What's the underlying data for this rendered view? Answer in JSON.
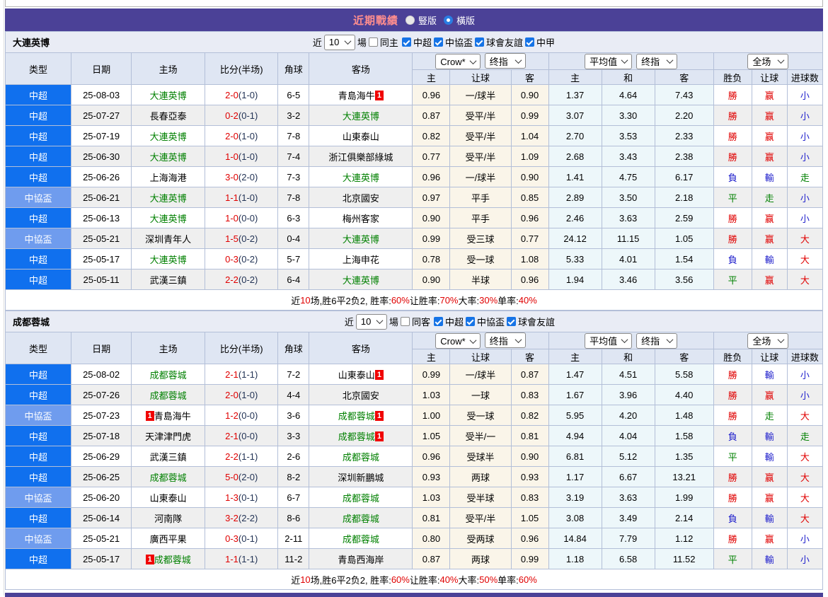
{
  "colors": {
    "header_purple": "#4b4197",
    "title_pink": "#ff8e8e",
    "type_colors": {
      "中超": "#1070ee",
      "中協盃": "#6f9cee"
    },
    "result_colors": {
      "勝": "red",
      "負": "blue",
      "平": "green",
      "赢": "red",
      "輸": "blue",
      "走": "green",
      "大": "red",
      "小": "blue"
    },
    "focus_team_green": "#008000",
    "score_red": "#e00000"
  },
  "title_bar": {
    "title": "近期戰績",
    "radios": [
      {
        "label": "豎版",
        "checked": false
      },
      {
        "label": "橫版",
        "checked": true
      }
    ]
  },
  "table_header": {
    "left_cols": [
      "类型",
      "日期",
      "主场",
      "比分(半场)",
      "角球",
      "客场"
    ],
    "groups": [
      {
        "selects": [
          "Crow*",
          "终指"
        ],
        "cols": [
          "主",
          "让球",
          "客"
        ]
      },
      {
        "selects": [
          "平均值",
          "终指"
        ],
        "cols": [
          "主",
          "和",
          "客"
        ]
      },
      {
        "selects": [
          "全场"
        ],
        "cols": [
          "胜负",
          "让球",
          "进球数"
        ]
      }
    ]
  },
  "sections": [
    {
      "team": "大連英博",
      "filter": {
        "near": "近",
        "games": "10",
        "unit": "場",
        "same": {
          "label": "同主",
          "checked": false
        },
        "leagues": [
          {
            "label": "中超",
            "checked": true
          },
          {
            "label": "中協盃",
            "checked": true
          },
          {
            "label": "球會友誼",
            "checked": true
          },
          {
            "label": "中甲",
            "checked": true
          }
        ]
      },
      "rows": [
        {
          "type": "中超",
          "date": "25-08-03",
          "home": {
            "name": "大連英博",
            "focus": true
          },
          "away": {
            "name": "青島海牛",
            "focus": false,
            "card": "after"
          },
          "score_ft": "2-0",
          "score_ht": "(1-0)",
          "corners": "6-5",
          "handicap": [
            "0.96",
            "一/球半",
            "0.90"
          ],
          "avg": [
            "1.37",
            "4.64",
            "7.43"
          ],
          "results": [
            "勝",
            "赢",
            "小"
          ]
        },
        {
          "type": "中超",
          "date": "25-07-27",
          "home": {
            "name": "長春亞泰",
            "focus": false
          },
          "away": {
            "name": "大連英博",
            "focus": true
          },
          "score_ft": "0-2",
          "score_ht": "(0-1)",
          "corners": "3-2",
          "handicap": [
            "0.87",
            "受平/半",
            "0.99"
          ],
          "avg": [
            "3.07",
            "3.30",
            "2.20"
          ],
          "results": [
            "勝",
            "赢",
            "小"
          ]
        },
        {
          "type": "中超",
          "date": "25-07-19",
          "home": {
            "name": "大連英博",
            "focus": true
          },
          "away": {
            "name": "山東泰山",
            "focus": false
          },
          "score_ft": "2-0",
          "score_ht": "(1-0)",
          "corners": "7-8",
          "handicap": [
            "0.82",
            "受平/半",
            "1.04"
          ],
          "avg": [
            "2.70",
            "3.53",
            "2.33"
          ],
          "results": [
            "勝",
            "赢",
            "小"
          ]
        },
        {
          "type": "中超",
          "date": "25-06-30",
          "home": {
            "name": "大連英博",
            "focus": true
          },
          "away": {
            "name": "浙江俱樂部綠城",
            "focus": false
          },
          "score_ft": "1-0",
          "score_ht": "(1-0)",
          "corners": "7-4",
          "handicap": [
            "0.77",
            "受平/半",
            "1.09"
          ],
          "avg": [
            "2.68",
            "3.43",
            "2.38"
          ],
          "results": [
            "勝",
            "赢",
            "小"
          ]
        },
        {
          "type": "中超",
          "date": "25-06-26",
          "home": {
            "name": "上海海港",
            "focus": false
          },
          "away": {
            "name": "大連英博",
            "focus": true
          },
          "score_ft": "3-0",
          "score_ht": "(2-0)",
          "corners": "7-3",
          "handicap": [
            "0.96",
            "一/球半",
            "0.90"
          ],
          "avg": [
            "1.41",
            "4.75",
            "6.17"
          ],
          "results": [
            "負",
            "輸",
            "走"
          ]
        },
        {
          "type": "中協盃",
          "date": "25-06-21",
          "home": {
            "name": "大連英博",
            "focus": true
          },
          "away": {
            "name": "北京國安",
            "focus": false
          },
          "score_ft": "1-1",
          "score_ht": "(1-0)",
          "corners": "7-8",
          "handicap": [
            "0.97",
            "平手",
            "0.85"
          ],
          "avg": [
            "2.89",
            "3.50",
            "2.18"
          ],
          "results": [
            "平",
            "走",
            "小"
          ]
        },
        {
          "type": "中超",
          "date": "25-06-13",
          "home": {
            "name": "大連英博",
            "focus": true
          },
          "away": {
            "name": "梅州客家",
            "focus": false
          },
          "score_ft": "1-0",
          "score_ht": "(0-0)",
          "corners": "6-3",
          "handicap": [
            "0.90",
            "平手",
            "0.96"
          ],
          "avg": [
            "2.46",
            "3.63",
            "2.59"
          ],
          "results": [
            "勝",
            "赢",
            "小"
          ]
        },
        {
          "type": "中協盃",
          "date": "25-05-21",
          "home": {
            "name": "深圳青年人",
            "focus": false
          },
          "away": {
            "name": "大連英博",
            "focus": true
          },
          "score_ft": "1-5",
          "score_ht": "(0-2)",
          "corners": "0-4",
          "handicap": [
            "0.99",
            "受三球",
            "0.77"
          ],
          "avg": [
            "24.12",
            "11.15",
            "1.05"
          ],
          "results": [
            "勝",
            "赢",
            "大"
          ]
        },
        {
          "type": "中超",
          "date": "25-05-17",
          "home": {
            "name": "大連英博",
            "focus": true
          },
          "away": {
            "name": "上海申花",
            "focus": false
          },
          "score_ft": "0-3",
          "score_ht": "(0-2)",
          "corners": "5-7",
          "handicap": [
            "0.78",
            "受一球",
            "1.08"
          ],
          "avg": [
            "5.33",
            "4.01",
            "1.54"
          ],
          "results": [
            "負",
            "輸",
            "大"
          ]
        },
        {
          "type": "中超",
          "date": "25-05-11",
          "home": {
            "name": "武漢三鎮",
            "focus": false
          },
          "away": {
            "name": "大連英博",
            "focus": true
          },
          "score_ft": "2-2",
          "score_ht": "(0-2)",
          "corners": "6-4",
          "handicap": [
            "0.90",
            "半球",
            "0.96"
          ],
          "avg": [
            "1.94",
            "3.46",
            "3.56"
          ],
          "results": [
            "平",
            "赢",
            "大"
          ]
        }
      ],
      "summary": [
        {
          "t": "近",
          "c": "k"
        },
        {
          "t": "10",
          "c": "r"
        },
        {
          "t": "场,胜6平2负2, 胜率:",
          "c": "k"
        },
        {
          "t": "60%",
          "c": "r"
        },
        {
          "t": " 让胜率:",
          "c": "k"
        },
        {
          "t": "70%",
          "c": "r"
        },
        {
          "t": " 大率:",
          "c": "k"
        },
        {
          "t": "30%",
          "c": "r"
        },
        {
          "t": " 单率:",
          "c": "k"
        },
        {
          "t": "40%",
          "c": "r"
        }
      ]
    },
    {
      "team": "成都蓉城",
      "filter": {
        "near": "近",
        "games": "10",
        "unit": "場",
        "same": {
          "label": "同客",
          "checked": false
        },
        "leagues": [
          {
            "label": "中超",
            "checked": true
          },
          {
            "label": "中協盃",
            "checked": true
          },
          {
            "label": "球會友誼",
            "checked": true
          }
        ]
      },
      "rows": [
        {
          "type": "中超",
          "date": "25-08-02",
          "home": {
            "name": "成都蓉城",
            "focus": true
          },
          "away": {
            "name": "山東泰山",
            "focus": false,
            "card": "after"
          },
          "score_ft": "2-1",
          "score_ht": "(1-1)",
          "corners": "7-2",
          "handicap": [
            "0.99",
            "一/球半",
            "0.87"
          ],
          "avg": [
            "1.47",
            "4.51",
            "5.58"
          ],
          "results": [
            "勝",
            "輸",
            "小"
          ]
        },
        {
          "type": "中超",
          "date": "25-07-26",
          "home": {
            "name": "成都蓉城",
            "focus": true
          },
          "away": {
            "name": "北京國安",
            "focus": false
          },
          "score_ft": "2-0",
          "score_ht": "(1-0)",
          "corners": "4-4",
          "handicap": [
            "1.03",
            "一球",
            "0.83"
          ],
          "avg": [
            "1.67",
            "3.96",
            "4.40"
          ],
          "results": [
            "勝",
            "赢",
            "小"
          ]
        },
        {
          "type": "中協盃",
          "date": "25-07-23",
          "home": {
            "name": "青島海牛",
            "focus": false,
            "card": "before"
          },
          "away": {
            "name": "成都蓉城",
            "focus": true,
            "card": "after"
          },
          "score_ft": "1-2",
          "score_ht": "(0-0)",
          "corners": "3-6",
          "handicap": [
            "1.00",
            "受一球",
            "0.82"
          ],
          "avg": [
            "5.95",
            "4.20",
            "1.48"
          ],
          "results": [
            "勝",
            "走",
            "大"
          ]
        },
        {
          "type": "中超",
          "date": "25-07-18",
          "home": {
            "name": "天津津門虎",
            "focus": false
          },
          "away": {
            "name": "成都蓉城",
            "focus": true,
            "card": "after"
          },
          "score_ft": "2-1",
          "score_ht": "(0-0)",
          "corners": "3-3",
          "handicap": [
            "1.05",
            "受半/一",
            "0.81"
          ],
          "avg": [
            "4.94",
            "4.04",
            "1.58"
          ],
          "results": [
            "負",
            "輸",
            "走"
          ]
        },
        {
          "type": "中超",
          "date": "25-06-29",
          "home": {
            "name": "武漢三鎮",
            "focus": false
          },
          "away": {
            "name": "成都蓉城",
            "focus": true
          },
          "score_ft": "2-2",
          "score_ht": "(1-1)",
          "corners": "2-6",
          "handicap": [
            "0.96",
            "受球半",
            "0.90"
          ],
          "avg": [
            "6.81",
            "5.12",
            "1.35"
          ],
          "results": [
            "平",
            "輸",
            "大"
          ]
        },
        {
          "type": "中超",
          "date": "25-06-25",
          "home": {
            "name": "成都蓉城",
            "focus": true
          },
          "away": {
            "name": "深圳新鵬城",
            "focus": false
          },
          "score_ft": "5-0",
          "score_ht": "(2-0)",
          "corners": "8-2",
          "handicap": [
            "0.93",
            "两球",
            "0.93"
          ],
          "avg": [
            "1.17",
            "6.67",
            "13.21"
          ],
          "results": [
            "勝",
            "赢",
            "大"
          ]
        },
        {
          "type": "中協盃",
          "date": "25-06-20",
          "home": {
            "name": "山東泰山",
            "focus": false
          },
          "away": {
            "name": "成都蓉城",
            "focus": true
          },
          "score_ft": "1-3",
          "score_ht": "(0-1)",
          "corners": "6-7",
          "handicap": [
            "1.03",
            "受半球",
            "0.83"
          ],
          "avg": [
            "3.19",
            "3.63",
            "1.99"
          ],
          "results": [
            "勝",
            "赢",
            "大"
          ]
        },
        {
          "type": "中超",
          "date": "25-06-14",
          "home": {
            "name": "河南隊",
            "focus": false
          },
          "away": {
            "name": "成都蓉城",
            "focus": true
          },
          "score_ft": "3-2",
          "score_ht": "(2-2)",
          "corners": "8-6",
          "handicap": [
            "0.81",
            "受平/半",
            "1.05"
          ],
          "avg": [
            "3.08",
            "3.49",
            "2.14"
          ],
          "results": [
            "負",
            "輸",
            "大"
          ]
        },
        {
          "type": "中協盃",
          "date": "25-05-21",
          "home": {
            "name": "廣西平果",
            "focus": false
          },
          "away": {
            "name": "成都蓉城",
            "focus": true
          },
          "score_ft": "0-3",
          "score_ht": "(0-1)",
          "corners": "2-11",
          "handicap": [
            "0.80",
            "受两球",
            "0.96"
          ],
          "avg": [
            "14.84",
            "7.79",
            "1.12"
          ],
          "results": [
            "勝",
            "赢",
            "小"
          ]
        },
        {
          "type": "中超",
          "date": "25-05-17",
          "home": {
            "name": "成都蓉城",
            "focus": true,
            "card": "before"
          },
          "away": {
            "name": "青島西海岸",
            "focus": false
          },
          "score_ft": "1-1",
          "score_ht": "(1-1)",
          "corners": "11-2",
          "handicap": [
            "0.87",
            "两球",
            "0.99"
          ],
          "avg": [
            "1.18",
            "6.58",
            "11.52"
          ],
          "results": [
            "平",
            "輸",
            "小"
          ]
        }
      ],
      "summary": [
        {
          "t": "近",
          "c": "k"
        },
        {
          "t": "10",
          "c": "r"
        },
        {
          "t": "场,胜6平2负2, 胜率:",
          "c": "k"
        },
        {
          "t": "60%",
          "c": "r"
        },
        {
          "t": " 让胜率:",
          "c": "k"
        },
        {
          "t": "40%",
          "c": "r"
        },
        {
          "t": " 大率:",
          "c": "k"
        },
        {
          "t": "50%",
          "c": "r"
        },
        {
          "t": " 单率:",
          "c": "k"
        },
        {
          "t": "60%",
          "c": "r"
        }
      ]
    }
  ]
}
